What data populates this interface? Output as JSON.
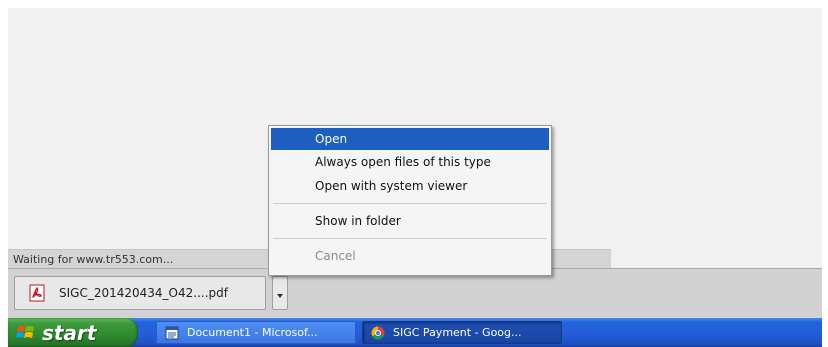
{
  "status_bar": {
    "text": "Waiting for www.tr553.com..."
  },
  "download_shelf": {
    "item": {
      "file_name": "SIGC_201420434_O42....pdf",
      "icon": "pdf-file-icon"
    },
    "dropdown_icon": "chevron-down-icon"
  },
  "context_menu": {
    "items": [
      {
        "label": "Open"
      },
      {
        "label": "Always open files of this type"
      },
      {
        "label": "Open with system viewer"
      },
      {
        "label": "Show in folder"
      },
      {
        "label": "Cancel"
      }
    ],
    "highlight_color": "#1c5fbf"
  },
  "taskbar": {
    "start_label": "start",
    "tasks": [
      {
        "label": "Document1 - Microsof...",
        "icon": "word-document-icon"
      },
      {
        "label": "SIGC Payment - Goog...",
        "icon": "chrome-icon"
      }
    ],
    "colors": {
      "taskbar_blue": "#245edb",
      "start_green": "#3c9a3c"
    }
  }
}
